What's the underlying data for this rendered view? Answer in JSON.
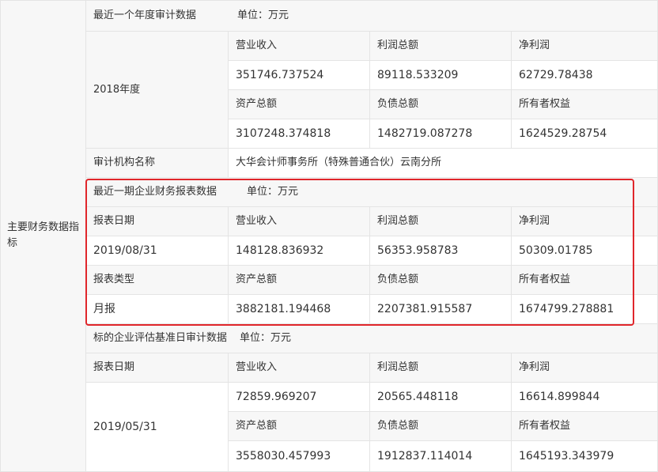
{
  "left_label": "主要财务数据指标",
  "section1": {
    "title": "最近一个年度审计数据",
    "unit": "单位：万元",
    "year": "2018年度",
    "row1_headers": [
      "营业收入",
      "利润总额",
      "净利润"
    ],
    "row1_values": [
      "351746.737524",
      "89118.533209",
      "62729.78438"
    ],
    "row2_headers": [
      "资产总额",
      "负债总额",
      "所有者权益"
    ],
    "row2_values": [
      "3107248.374818",
      "1482719.087278",
      "1624529.28754"
    ],
    "auditor_label": "审计机构名称",
    "auditor_value": "大华会计师事务所（特殊普通合伙）云南分所"
  },
  "section2": {
    "title": "最近一期企业财务报表数据",
    "unit": "单位：万元",
    "date_label": "报表日期",
    "date_value": "2019/08/31",
    "type_label": "报表类型",
    "type_value": "月报",
    "row1_headers": [
      "营业收入",
      "利润总额",
      "净利润"
    ],
    "row1_values": [
      "148128.836932",
      "56353.958783",
      "50309.01785"
    ],
    "row2_headers": [
      "资产总额",
      "负债总额",
      "所有者权益"
    ],
    "row2_values": [
      "3882181.194468",
      "2207381.915587",
      "1674799.278881"
    ]
  },
  "section3": {
    "title": "标的企业评估基准日审计数据",
    "unit": "单位：万元",
    "date_label": "报表日期",
    "date_value": "2019/05/31",
    "row1_headers": [
      "营业收入",
      "利润总额",
      "净利润"
    ],
    "row1_values": [
      "72859.969207",
      "20565.448118",
      "16614.899844"
    ],
    "row2_headers": [
      "资产总额",
      "负债总额",
      "所有者权益"
    ],
    "row2_values": [
      "3558030.457993",
      "1912837.114014",
      "1645193.343979"
    ]
  },
  "colors": {
    "border": "#e4e4e4",
    "label_bg": "#f7f7f7",
    "highlight": "#e0262b"
  }
}
